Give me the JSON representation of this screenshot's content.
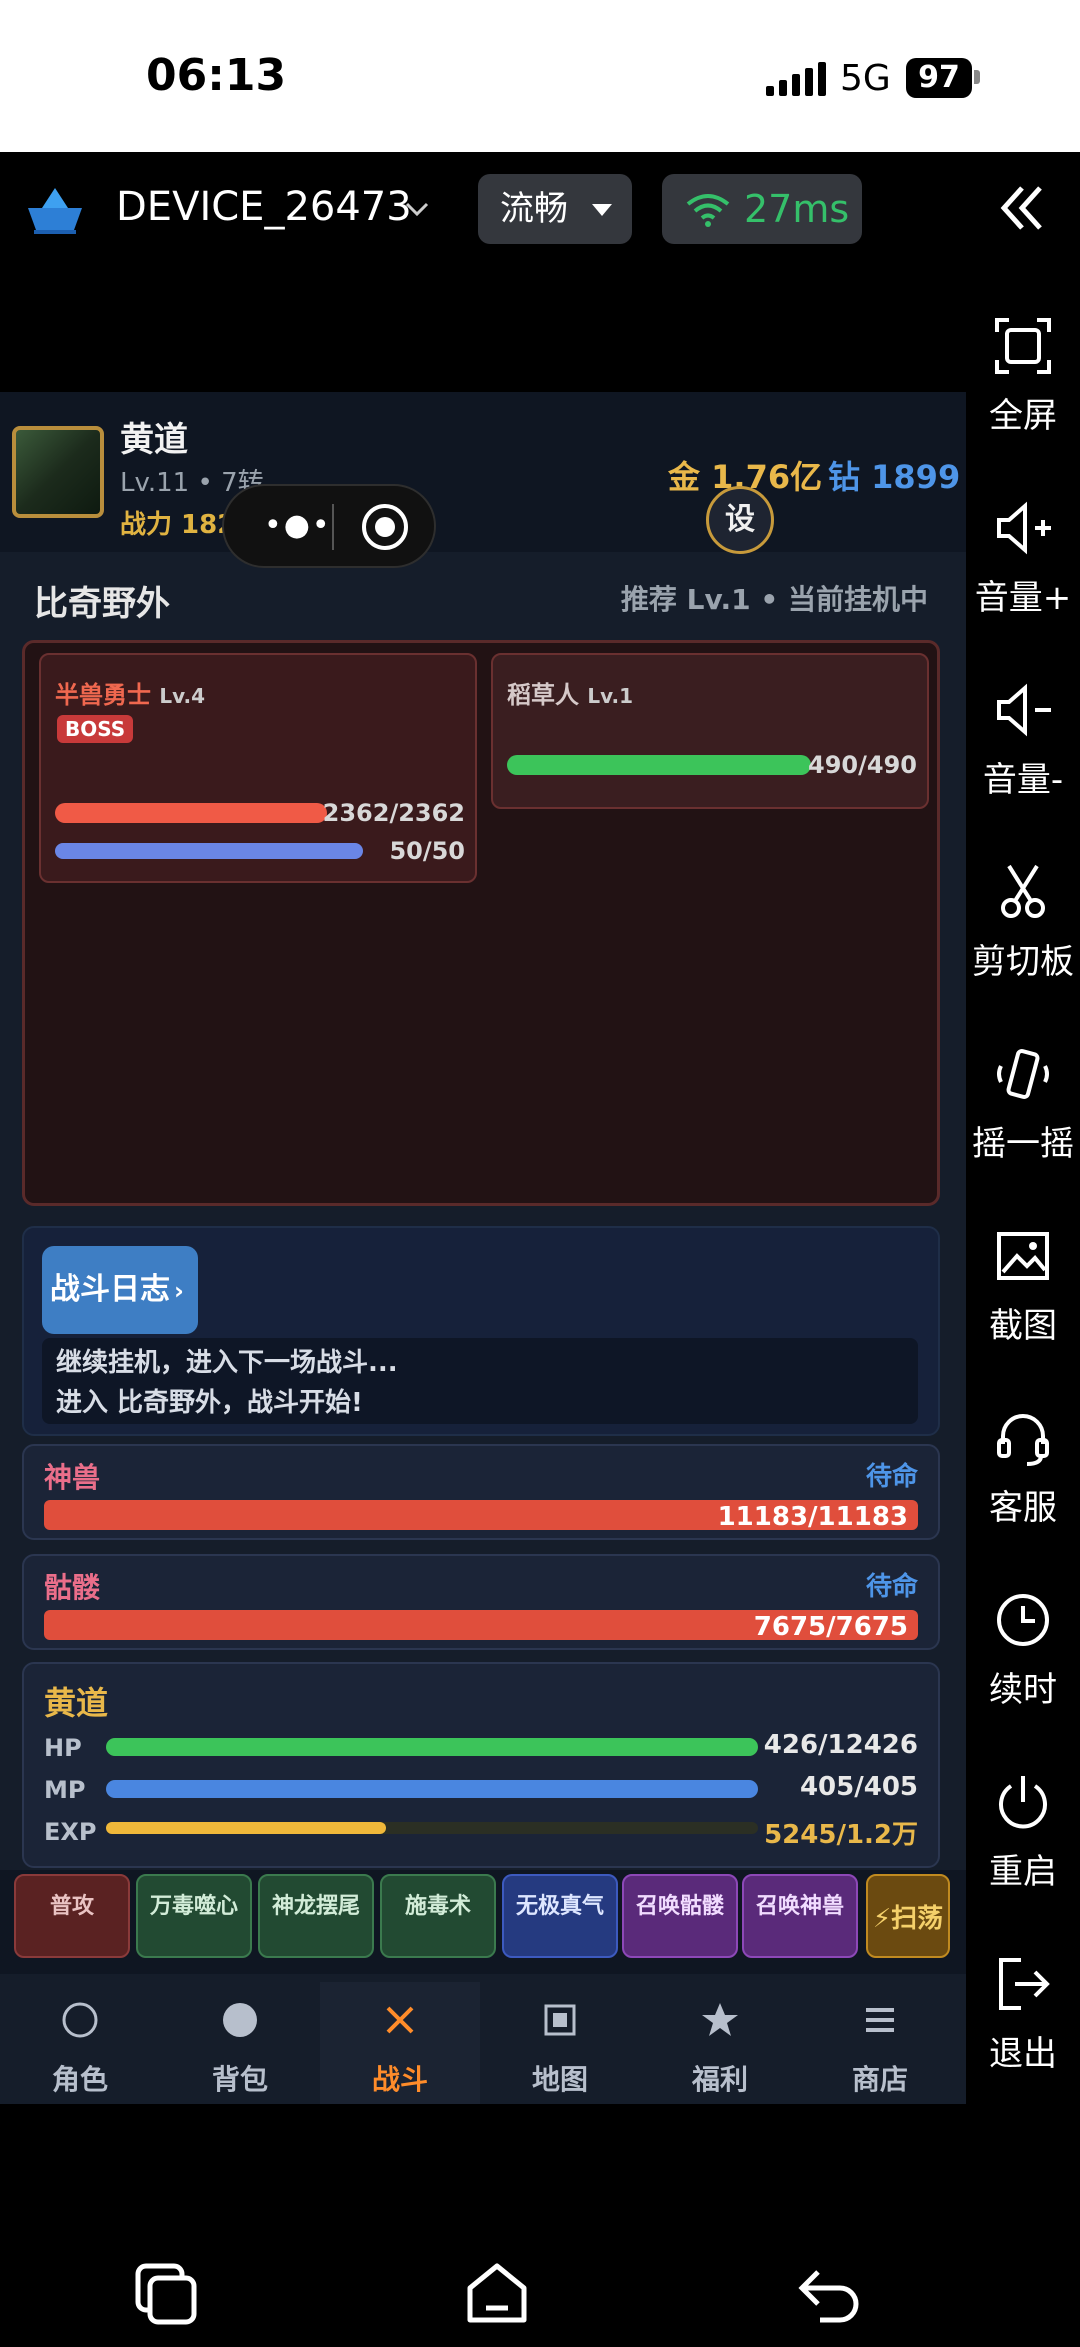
{
  "status_bar": {
    "time": "06:13",
    "network": "5G",
    "battery": "97"
  },
  "toolbar": {
    "device_name": "DEVICE_26473",
    "quality": "流畅",
    "ping": "27ms"
  },
  "side_panel": [
    {
      "label": "全屏",
      "icon": "fullscreen-icon"
    },
    {
      "label": "音量+",
      "icon": "volume-up-icon"
    },
    {
      "label": "音量-",
      "icon": "volume-down-icon"
    },
    {
      "label": "剪切板",
      "icon": "scissors-icon"
    },
    {
      "label": "摇一摇",
      "icon": "shake-icon"
    },
    {
      "label": "截图",
      "icon": "screenshot-icon"
    },
    {
      "label": "客服",
      "icon": "headset-icon"
    },
    {
      "label": "续时",
      "icon": "clock-icon"
    },
    {
      "label": "重启",
      "icon": "power-icon"
    },
    {
      "label": "退出",
      "icon": "exit-icon"
    }
  ],
  "game": {
    "player": {
      "name": "黄道",
      "level": "Lv.11 • 7转",
      "power": "战力 18254",
      "gold": "金 1.76亿",
      "diamond": "钻 1899",
      "settings_label": "设"
    },
    "zone": {
      "name": "比奇野外",
      "info": "推荐 Lv.1 • 当前挂机中"
    },
    "monsters": [
      {
        "name": "半兽勇士",
        "level": "Lv.4",
        "badge": "BOSS",
        "hp": "2362/2362",
        "mp": "50/50",
        "hp_fraction": 1.0,
        "mp_fraction": 1.0
      },
      {
        "name": "稻草人",
        "level": "Lv.1",
        "hp": "490/490",
        "hp_fraction": 1.0
      }
    ],
    "battle_log": {
      "button": "战斗日志",
      "arrow": "›",
      "lines": [
        "继续挂机，进入下一场战斗...",
        "进入 比奇野外，战斗开始!"
      ]
    },
    "pets": [
      {
        "name": "神兽",
        "state": "待命",
        "hp": "11183/11183"
      },
      {
        "name": "骷髅",
        "state": "待命",
        "hp": "7675/7675"
      }
    ],
    "player_stats": {
      "name": "黄道",
      "hp_label": "HP",
      "hp_value": "426/12426",
      "hp_fraction": 1.0,
      "mp_label": "MP",
      "mp_value": "405/405",
      "mp_fraction": 1.0,
      "exp_label": "EXP",
      "exp_value": "5245/1.2万",
      "exp_fraction": 0.43
    },
    "skills": [
      {
        "label": "普攻",
        "style": "red"
      },
      {
        "label": "万毒噬心",
        "style": "green"
      },
      {
        "label": "神龙摆尾",
        "style": "green"
      },
      {
        "label": "施毒术",
        "style": "green"
      },
      {
        "label": "无极真气",
        "style": "blue"
      },
      {
        "label": "召唤骷髅",
        "style": "purple"
      },
      {
        "label": "召唤神兽",
        "style": "purple"
      },
      {
        "label": "⚡扫荡",
        "style": "gold"
      }
    ],
    "tabs": [
      {
        "label": "角色",
        "icon": "circle-outline-icon"
      },
      {
        "label": "背包",
        "icon": "circle-filled-icon"
      },
      {
        "label": "战斗",
        "icon": "cross-icon",
        "active": true
      },
      {
        "label": "地图",
        "icon": "square-icon"
      },
      {
        "label": "福利",
        "icon": "star-icon"
      },
      {
        "label": "商店",
        "icon": "menu-icon"
      }
    ]
  },
  "colors": {
    "hp_bar": "#f05a46",
    "mp_bar": "#6a86e6",
    "green_bar": "#3cc45a",
    "player_mp": "#4a86e0",
    "exp_bar": "#f0b83a",
    "active_tab": "#ff8c2a"
  }
}
